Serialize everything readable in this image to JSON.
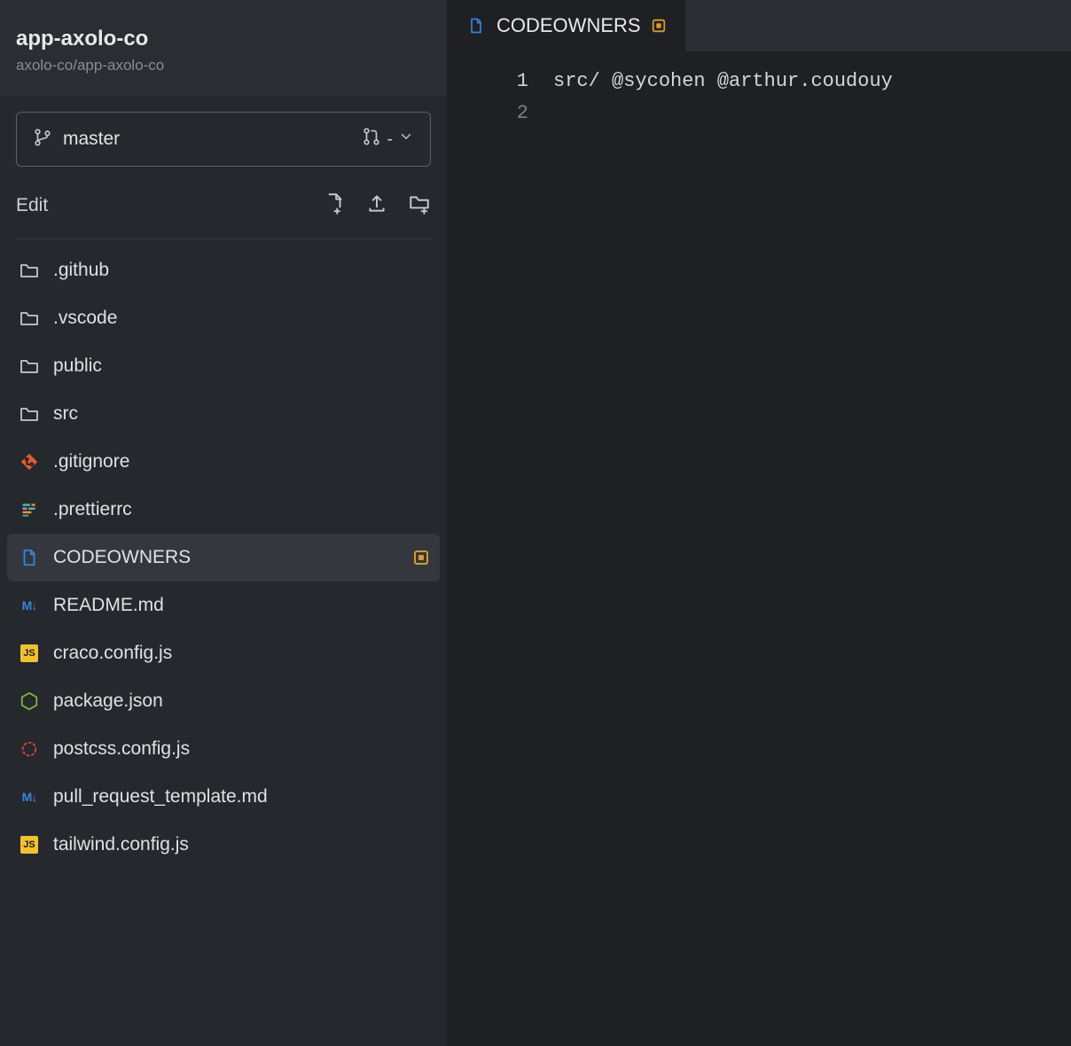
{
  "sidebar": {
    "repo_title": "app-axolo-co",
    "repo_path": "axolo-co/app-axolo-co",
    "branch": {
      "name": "master",
      "pr_indicator": "-"
    },
    "edit_label": "Edit",
    "files": [
      {
        "name": ".github",
        "icon": "folder",
        "selected": false,
        "modified": false
      },
      {
        "name": ".vscode",
        "icon": "folder",
        "selected": false,
        "modified": false
      },
      {
        "name": "public",
        "icon": "folder",
        "selected": false,
        "modified": false
      },
      {
        "name": "src",
        "icon": "folder",
        "selected": false,
        "modified": false
      },
      {
        "name": ".gitignore",
        "icon": "git",
        "selected": false,
        "modified": false
      },
      {
        "name": ".prettierrc",
        "icon": "prettier",
        "selected": false,
        "modified": false
      },
      {
        "name": "CODEOWNERS",
        "icon": "file-blue",
        "selected": true,
        "modified": true
      },
      {
        "name": "README.md",
        "icon": "md",
        "selected": false,
        "modified": false
      },
      {
        "name": "craco.config.js",
        "icon": "js",
        "selected": false,
        "modified": false
      },
      {
        "name": "package.json",
        "icon": "node",
        "selected": false,
        "modified": false
      },
      {
        "name": "postcss.config.js",
        "icon": "postcss",
        "selected": false,
        "modified": false
      },
      {
        "name": "pull_request_template.md",
        "icon": "md",
        "selected": false,
        "modified": false
      },
      {
        "name": "tailwind.config.js",
        "icon": "js",
        "selected": false,
        "modified": false
      }
    ]
  },
  "editor": {
    "tab": {
      "filename": "CODEOWNERS",
      "modified": true
    },
    "lines": [
      "src/ @sycohen @arthur.coudouy",
      ""
    ]
  }
}
